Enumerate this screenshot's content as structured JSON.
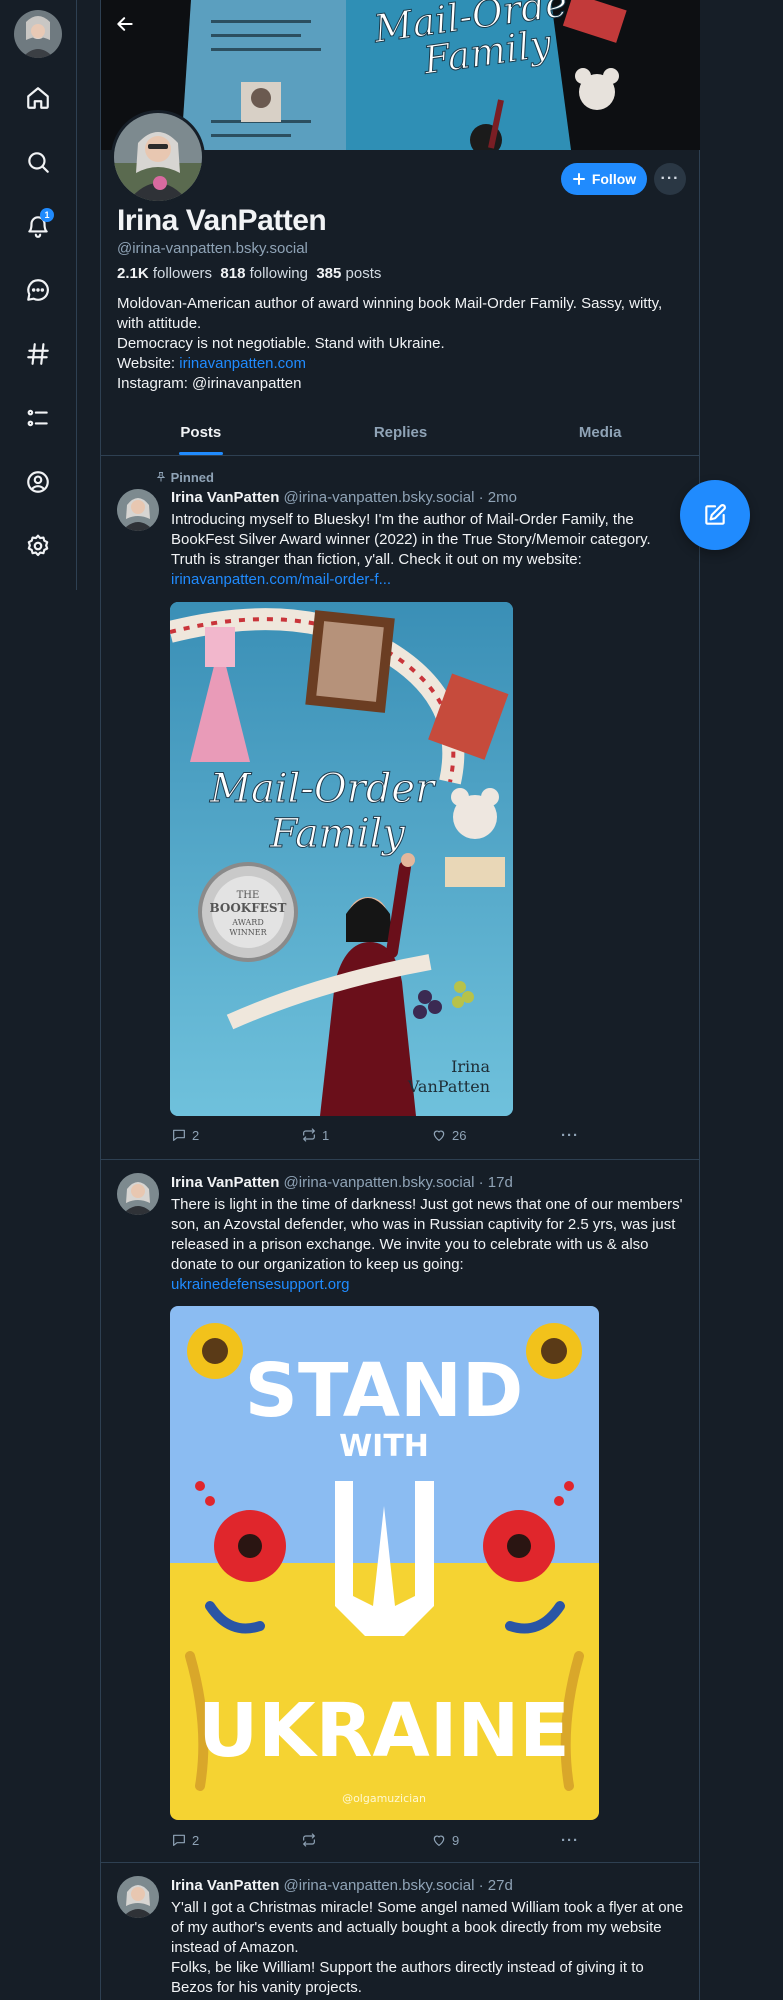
{
  "nav": {
    "items": [
      "home",
      "search",
      "notifications",
      "chat",
      "feeds",
      "lists",
      "profile",
      "settings"
    ],
    "notification_count": "1"
  },
  "profile": {
    "display_name": "Irina VanPatten",
    "handle": "@irina-vanpatten.bsky.social",
    "followers_count": "2.1K",
    "followers_label": "followers",
    "following_count": "818",
    "following_label": "following",
    "posts_count": "385",
    "posts_label": "posts",
    "bio_line1": "Moldovan-American author of award winning book Mail-Order Family. Sassy, witty, with attitude.",
    "bio_line2": "Democracy is not negotiable. Stand with Ukraine.",
    "bio_website_label": "Website:",
    "bio_website_link": "irinavanpatten.com",
    "bio_instagram": "Instagram: @irinavanpatten",
    "follow_label": "Follow",
    "banner_title": "Mail-Order Family"
  },
  "tabs": [
    "Posts",
    "Replies",
    "Media"
  ],
  "posts": [
    {
      "pinned_label": "Pinned",
      "author": "Irina VanPatten",
      "handle": "@irina-vanpatten.bsky.social",
      "time": "· 2mo",
      "text": "Introducing myself to Bluesky! I'm the author of Mail-Order Family, the BookFest Silver Award winner (2022) in the True Story/Memoir category. Truth is stranger than fiction, y'all. Check it out on my website:",
      "link": "irinavanpatten.com/mail-order-f...",
      "image": {
        "title_line1": "Mail-Order",
        "title_line2": "Family",
        "seal_line1": "THE",
        "seal_line2": "BOOKFEST",
        "seal_line3": "AWARD",
        "seal_line4": "WINNER",
        "author_line1": "Irina",
        "author_line2": "VanPatten"
      },
      "replies": "2",
      "reposts": "1",
      "likes": "26"
    },
    {
      "author": "Irina VanPatten",
      "handle": "@irina-vanpatten.bsky.social",
      "time": "· 17d",
      "text": "There is light in the time of darkness! Just got news that one of our members' son, an Azovstal defender, who was in Russian captivity for 2.5 yrs, was just released in a prison exchange. We invite you to celebrate with us & also donate to our organization to keep us going:",
      "link": "ukrainedefensesupport.org",
      "image": {
        "line1": "STAND",
        "line2": "WITH",
        "line3": "UKRAINE",
        "credit": "@olgamuzician"
      },
      "replies": "2",
      "reposts": "",
      "likes": "9"
    },
    {
      "author": "Irina VanPatten",
      "handle": "@irina-vanpatten.bsky.social",
      "time": "· 27d",
      "text": "Y'all I got a Christmas miracle! Some angel named William took a flyer at one of my author's events and actually bought a book directly from my website instead of Amazon.",
      "text2": "Folks, be like William! Support the authors directly instead of giving it to Bezos for his vanity projects."
    }
  ],
  "colors": {
    "background": "#161e27",
    "accent": "#208bfe",
    "border": "#2e4052",
    "muted": "#8fa3b6",
    "ukraine_blue": "#8bbcf2",
    "ukraine_yellow": "#f5d332"
  }
}
